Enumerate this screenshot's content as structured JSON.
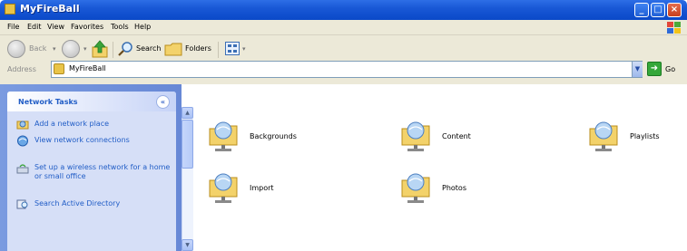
{
  "window": {
    "title": "MyFireBall",
    "caption_buttons": {
      "minimize": "_",
      "maximize": "□",
      "close": "×"
    }
  },
  "menu": [
    "File",
    "Edit",
    "View",
    "Favorites",
    "Tools",
    "Help"
  ],
  "toolbar": {
    "back_label": "Back",
    "search_label": "Search",
    "folders_label": "Folders"
  },
  "address": {
    "label": "Address",
    "value": "MyFireBall",
    "go_label": "Go"
  },
  "taskpane": {
    "title": "Network Tasks",
    "items": [
      {
        "label": "Add a network place",
        "icon": "network-place-icon"
      },
      {
        "label": "View network connections",
        "icon": "network-connections-icon"
      },
      {
        "label": "Set up a wireless network for a home or small office",
        "icon": "wireless-network-icon"
      },
      {
        "label": "Search Active Directory",
        "icon": "search-directory-icon"
      }
    ]
  },
  "folders": [
    {
      "name": "Backgrounds",
      "icon": "network-folder-icon"
    },
    {
      "name": "Content",
      "icon": "network-folder-icon"
    },
    {
      "name": "Playlists",
      "icon": "network-folder-icon"
    },
    {
      "name": "Import",
      "icon": "network-folder-icon"
    },
    {
      "name": "Photos",
      "icon": "network-folder-icon"
    }
  ],
  "colors": {
    "titlebar": "#0a49c8",
    "chrome": "#ece9d8",
    "taskpane": "#6788d6",
    "taskpane_link": "#215dc6",
    "folder": "#f3d26a"
  }
}
